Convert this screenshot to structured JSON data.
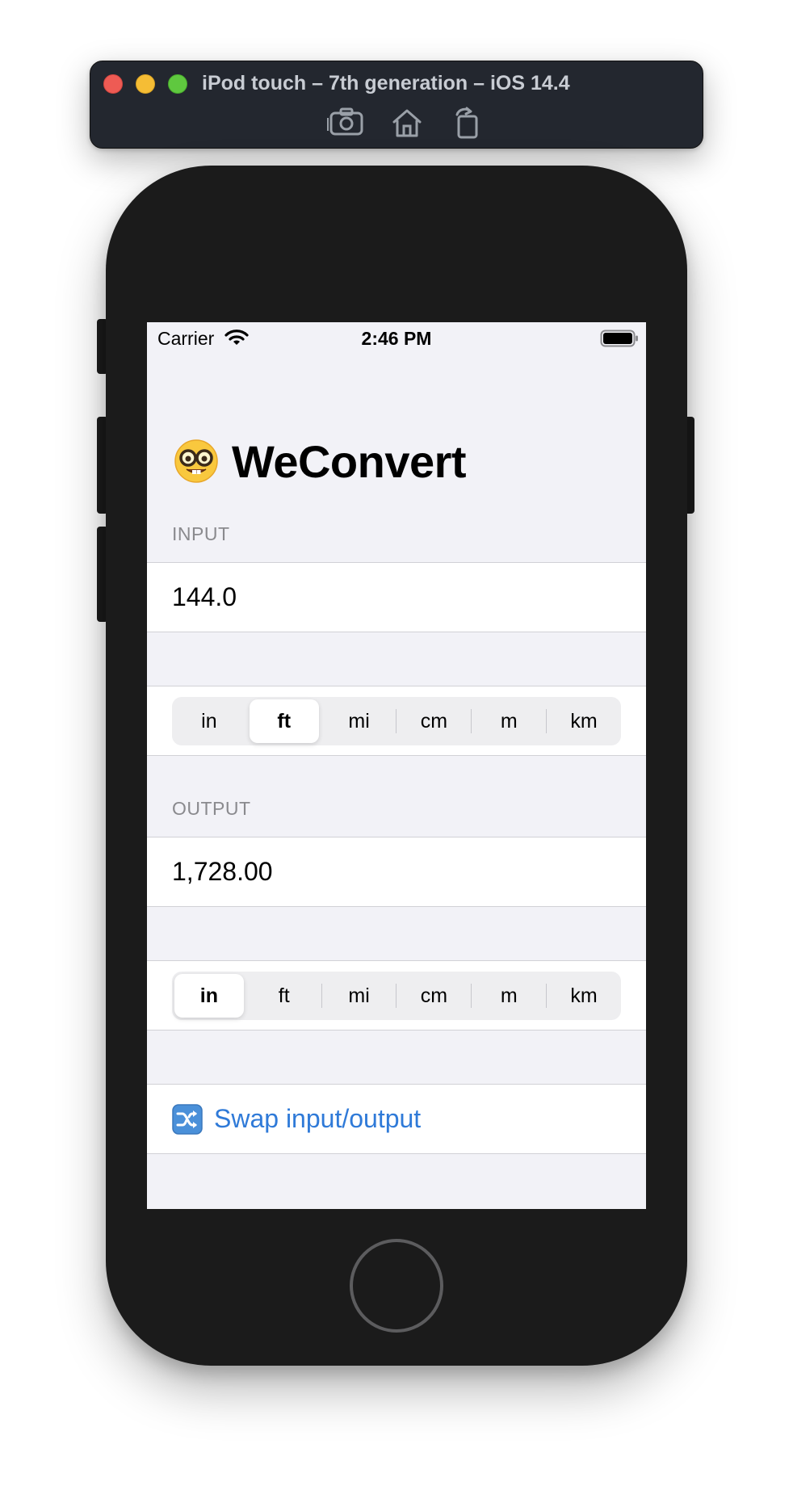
{
  "simulator": {
    "title": "iPod touch – 7th generation – iOS 14.4",
    "buttons": [
      "screenshot-icon",
      "home-icon",
      "rotate-icon"
    ]
  },
  "status_bar": {
    "carrier": "Carrier",
    "time": "2:46 PM"
  },
  "app": {
    "title": "WeConvert",
    "title_emoji": "nerd-face-emoji"
  },
  "input": {
    "header": "INPUT",
    "value": "144.0",
    "units": [
      "in",
      "ft",
      "mi",
      "cm",
      "m",
      "km"
    ],
    "selected_unit": "ft"
  },
  "output": {
    "header": "OUTPUT",
    "value": "1,728.00",
    "units": [
      "in",
      "ft",
      "mi",
      "cm",
      "m",
      "km"
    ],
    "selected_unit": "in"
  },
  "swap": {
    "label": "Swap input/output",
    "icon": "shuffle-icon"
  },
  "colors": {
    "accent": "#2f7ad8",
    "background": "#f2f2f7"
  }
}
